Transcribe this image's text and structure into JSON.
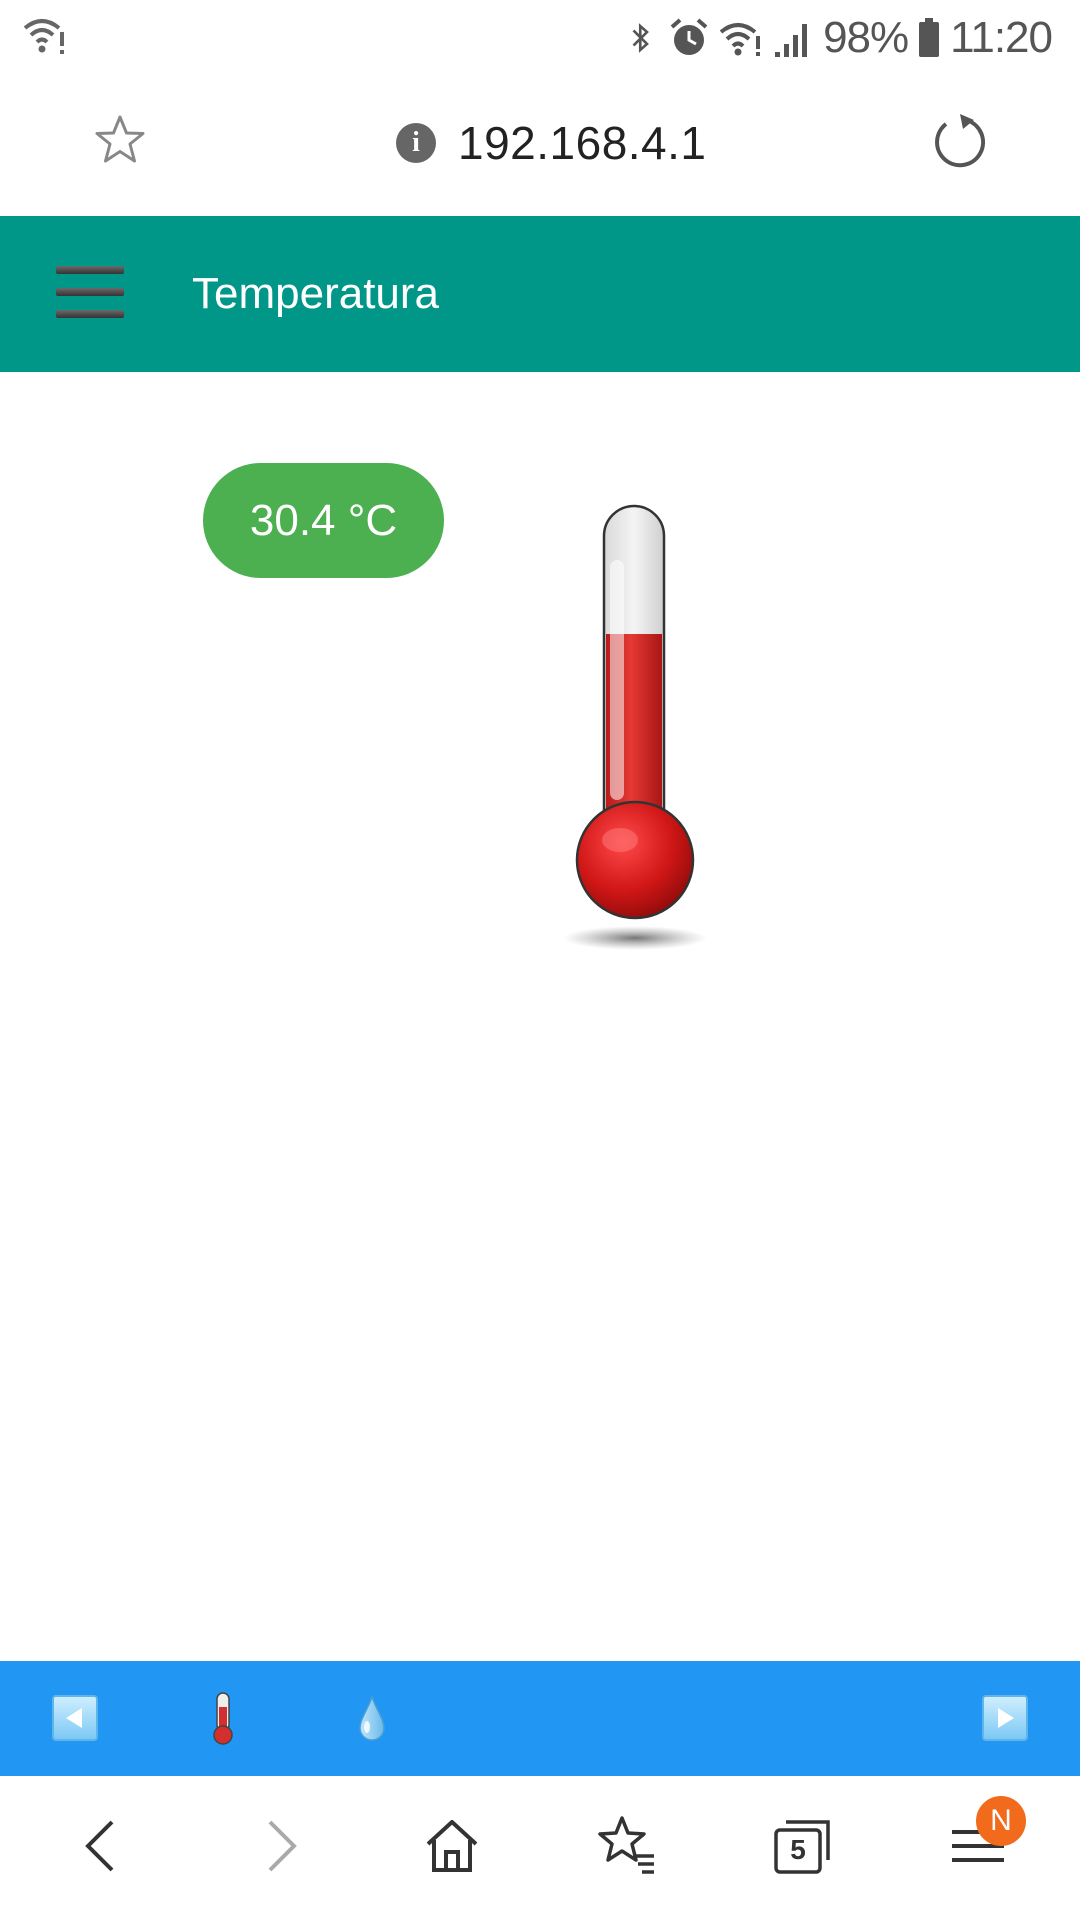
{
  "status_bar": {
    "battery": "98%",
    "time": "11:20",
    "icons": [
      "wifi-alert-icon",
      "bluetooth-icon",
      "alarm-icon",
      "wifi-icon",
      "signal-icon",
      "battery-icon"
    ]
  },
  "browser": {
    "url": "192.168.4.1",
    "icons": [
      "star-icon",
      "info-icon",
      "reload-icon"
    ],
    "info_glyph": "i",
    "nav_icons": [
      "back-icon",
      "forward-icon",
      "home-icon",
      "bookmarks-icon",
      "tabs-icon",
      "menu-icon"
    ],
    "tabs_count": "5",
    "menu_badge": "N"
  },
  "app": {
    "header_title": "Temperatura",
    "menu_icon": "hamburger-icon",
    "temperature_label": "30.4 °C",
    "temperature_value": 30.4,
    "thermometer_fill_fraction": 0.62,
    "colors": {
      "header": "#009688",
      "badge": "#4caf50",
      "strip": "#2196f3",
      "mercury": "#d32f2f",
      "menu_badge": "#f26b1d"
    }
  },
  "bottom_strip": {
    "icons": [
      "prev-arrow-icon",
      "thermometer-icon",
      "water-drop-icon",
      "next-arrow-icon"
    ]
  }
}
